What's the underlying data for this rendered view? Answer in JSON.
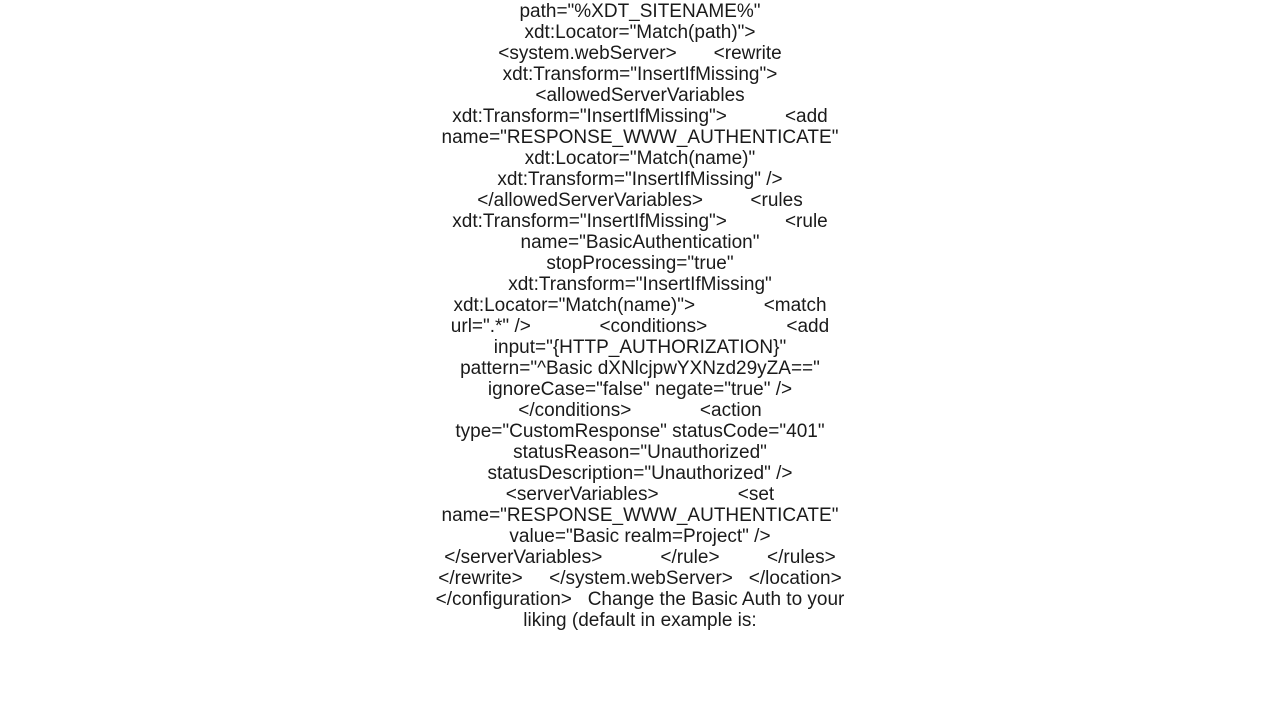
{
  "doc": {
    "text": "-Document-Transform\">   <location path=\"%XDT_SITENAME%\" xdt:Locator=\"Match(path)\">     <system.webServer>       <rewrite xdt:Transform=\"InsertIfMissing\">         <allowedServerVariables xdt:Transform=\"InsertIfMissing\">           <add name=\"RESPONSE_WWW_AUTHENTICATE\" xdt:Locator=\"Match(name)\" xdt:Transform=\"InsertIfMissing\" />         </allowedServerVariables>         <rules xdt:Transform=\"InsertIfMissing\">           <rule name=\"BasicAuthentication\" stopProcessing=\"true\" xdt:Transform=\"InsertIfMissing\" xdt:Locator=\"Match(name)\">             <match url=\".*\" />             <conditions>               <add input=\"{HTTP_AUTHORIZATION}\" pattern=\"^Basic dXNlcjpwYXNzd29yZA==\" ignoreCase=\"false\" negate=\"true\" />             </conditions>             <action type=\"CustomResponse\" statusCode=\"401\" statusReason=\"Unauthorized\" statusDescription=\"Unauthorized\" />             <serverVariables>               <set name=\"RESPONSE_WWW_AUTHENTICATE\" value=\"Basic realm=Project\" />             </serverVariables>           </rule>         </rules>       </rewrite>     </system.webServer>   </location> </configuration>   Change the Basic Auth to your liking (default in example is:"
  }
}
